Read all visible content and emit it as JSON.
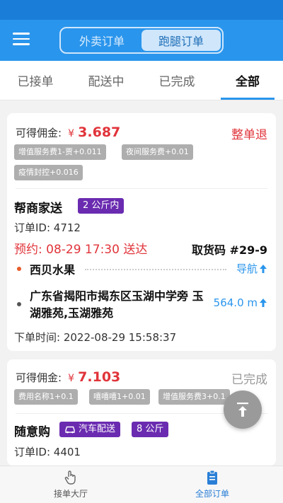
{
  "header": {
    "segments": [
      "外卖订单",
      "跑腿订单"
    ],
    "active_segment": "跑腿订单"
  },
  "tabs": [
    "已接单",
    "配送中",
    "已完成",
    "全部"
  ],
  "active_tab": "全部",
  "orders": [
    {
      "commission_label": "可得佣金:",
      "currency": "¥",
      "commission": "3.687",
      "status": "整单退",
      "fees": [
        "增值服务费1-贾+0.011",
        "夜间服务费+0.01",
        "疫情封控+0.016"
      ],
      "shop": "帮商家送",
      "weight_tag": "2 公斤内",
      "order_id": "订单ID: 4712",
      "appointment": "预约: 08-29  17:30 送达",
      "pickup_code": "取货码 #29-9",
      "from": "西贝水果",
      "nav_label": "导航",
      "address": "广东省揭阳市揭东区玉湖中学旁 玉湖雅苑,玉湖雅苑",
      "distance": "564.0 m",
      "order_time": "下单时间: 2022-08-29 15:58:37"
    },
    {
      "commission_label": "可得佣金:",
      "currency": "¥",
      "commission": "7.103",
      "status": "已完成",
      "fees": [
        "费用名称1+0.1",
        "嘻嘻嘻1+0.01",
        "增值服务费3+0.1"
      ],
      "shop": "随意购",
      "delivery_tag": "汽车配送",
      "weight_tag": "8 公斤",
      "order_id": "订单ID: 4401"
    }
  ],
  "bottom_nav": [
    "接单大厅",
    "全部订单"
  ],
  "active_bottom_nav": "全部订单",
  "colors": {
    "primary": "#2a95ec",
    "red": "#e0343a",
    "purple": "#6a2bb0",
    "tag_gray": "#aeaeae"
  },
  "icons": [
    "menu-icon",
    "arrow-up-icon",
    "car-icon",
    "scroll-top-icon",
    "hand-tap-icon",
    "clipboard-icon"
  ]
}
